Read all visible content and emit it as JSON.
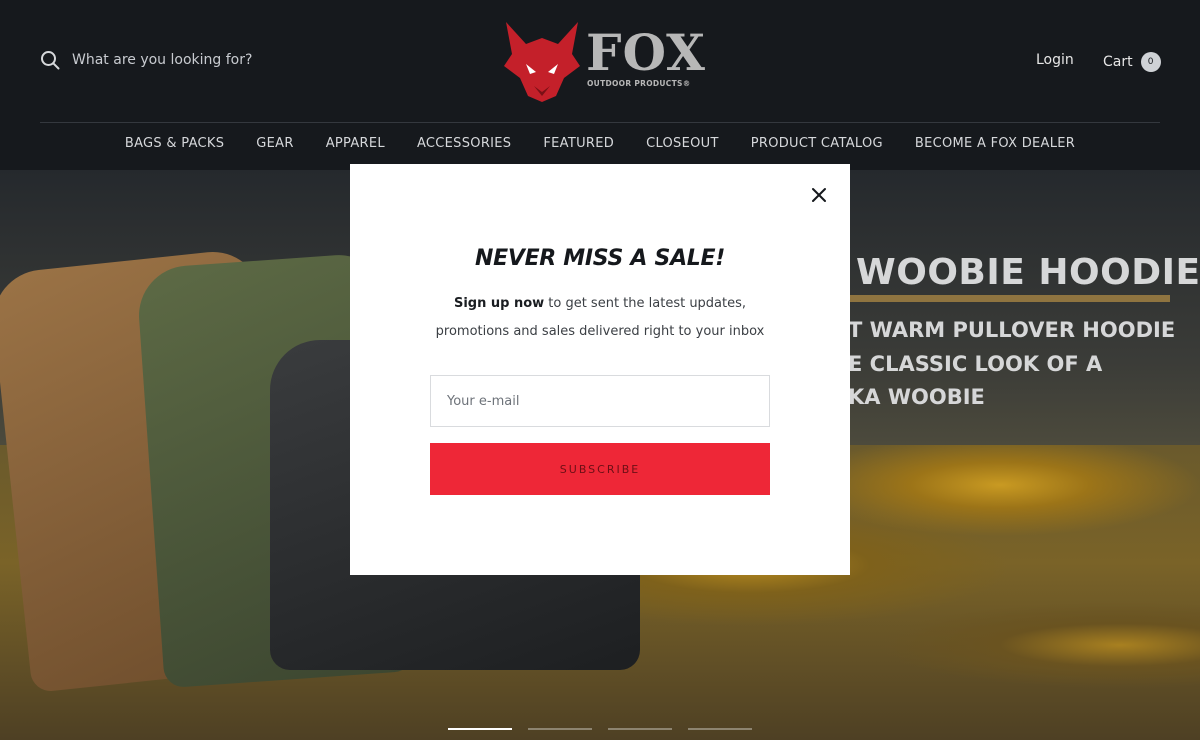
{
  "header": {
    "search_placeholder": "What are you looking for?",
    "logo_text": "FOX",
    "logo_subtext": "OUTDOOR PRODUCTS®",
    "login": "Login",
    "cart": "Cart",
    "cart_count": "0"
  },
  "nav": {
    "items": [
      {
        "label": "BAGS & PACKS"
      },
      {
        "label": "GEAR"
      },
      {
        "label": "APPAREL"
      },
      {
        "label": "ACCESSORIES"
      },
      {
        "label": "FEATURED"
      },
      {
        "label": "CLOSEOUT"
      },
      {
        "label": "PRODUCT CATALOG"
      },
      {
        "label": "BECOME A FOX DEALER"
      }
    ]
  },
  "hero": {
    "title": "WOOBIE HOODIE",
    "line1": "T WARM PULLOVER HOODIE",
    "line2": "E CLASSIC LOOK OF A",
    "line3": "KA WOOBIE",
    "slides": 4,
    "active_slide": 1
  },
  "modal": {
    "title": "NEVER MISS A SALE!",
    "text_strong": "Sign up now",
    "text_rest": " to get sent the latest updates,",
    "text_line2": "promotions and sales delivered right to your inbox",
    "email_placeholder": "Your e-mail",
    "subscribe_label": "SUBSCRIBE"
  },
  "colors": {
    "header_bg": "#16191d",
    "accent_red": "#ee2737",
    "logo_red": "#c4202a",
    "logo_gray": "#b7b7b7",
    "hero_underline": "#8f7440"
  },
  "icons": {
    "search": "search-icon",
    "close": "close-icon",
    "logo": "fox-head-logo"
  }
}
